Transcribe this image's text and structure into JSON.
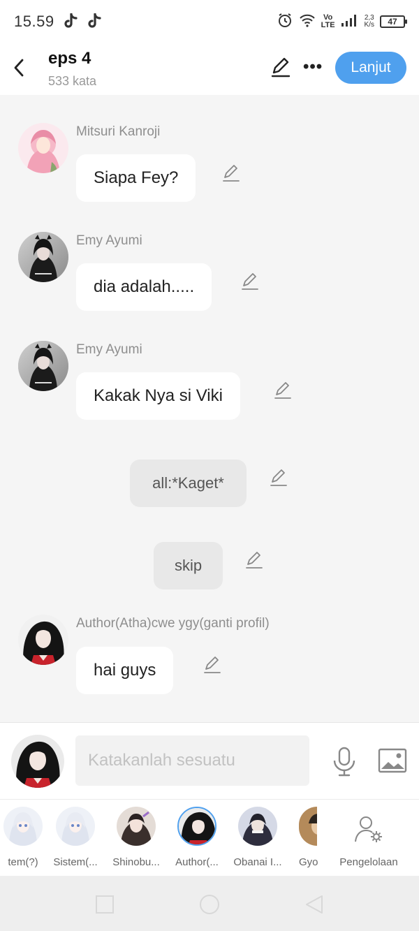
{
  "status_bar": {
    "time": "15.59",
    "net_speed_value": "2,3",
    "net_speed_unit": "K/s",
    "volte_top": "Vo",
    "volte_bottom": "LTE",
    "battery": "47"
  },
  "header": {
    "title": "eps 4",
    "word_count": "533 kata",
    "next_button": "Lanjut"
  },
  "messages": [
    {
      "sender": "Mitsuri Kanroji",
      "text": "Siapa Fey?"
    },
    {
      "sender": "Emy Ayumi",
      "text": "dia adalah....."
    },
    {
      "sender": "Emy Ayumi",
      "text": "Kakak Nya si Viki"
    },
    {
      "sender": "",
      "text": "all:*Kaget*"
    },
    {
      "sender": "",
      "text": "skip"
    },
    {
      "sender": "Author(Atha)cwe ygy(ganti profil)",
      "text": "hai guys"
    }
  ],
  "input": {
    "placeholder": "Katakanlah sesuatu"
  },
  "characters": [
    {
      "name": "tem(?)"
    },
    {
      "name": "Sistem(..."
    },
    {
      "name": "Shinobu..."
    },
    {
      "name": "Author(..."
    },
    {
      "name": "Obanai I..."
    },
    {
      "name": "Gyo"
    }
  ],
  "manage_label": "Pengelolaan",
  "colors": {
    "accent": "#4fa0ee",
    "background": "#f5f5f5",
    "bubble": "#ffffff",
    "narration_bubble": "#e8e8e8"
  }
}
